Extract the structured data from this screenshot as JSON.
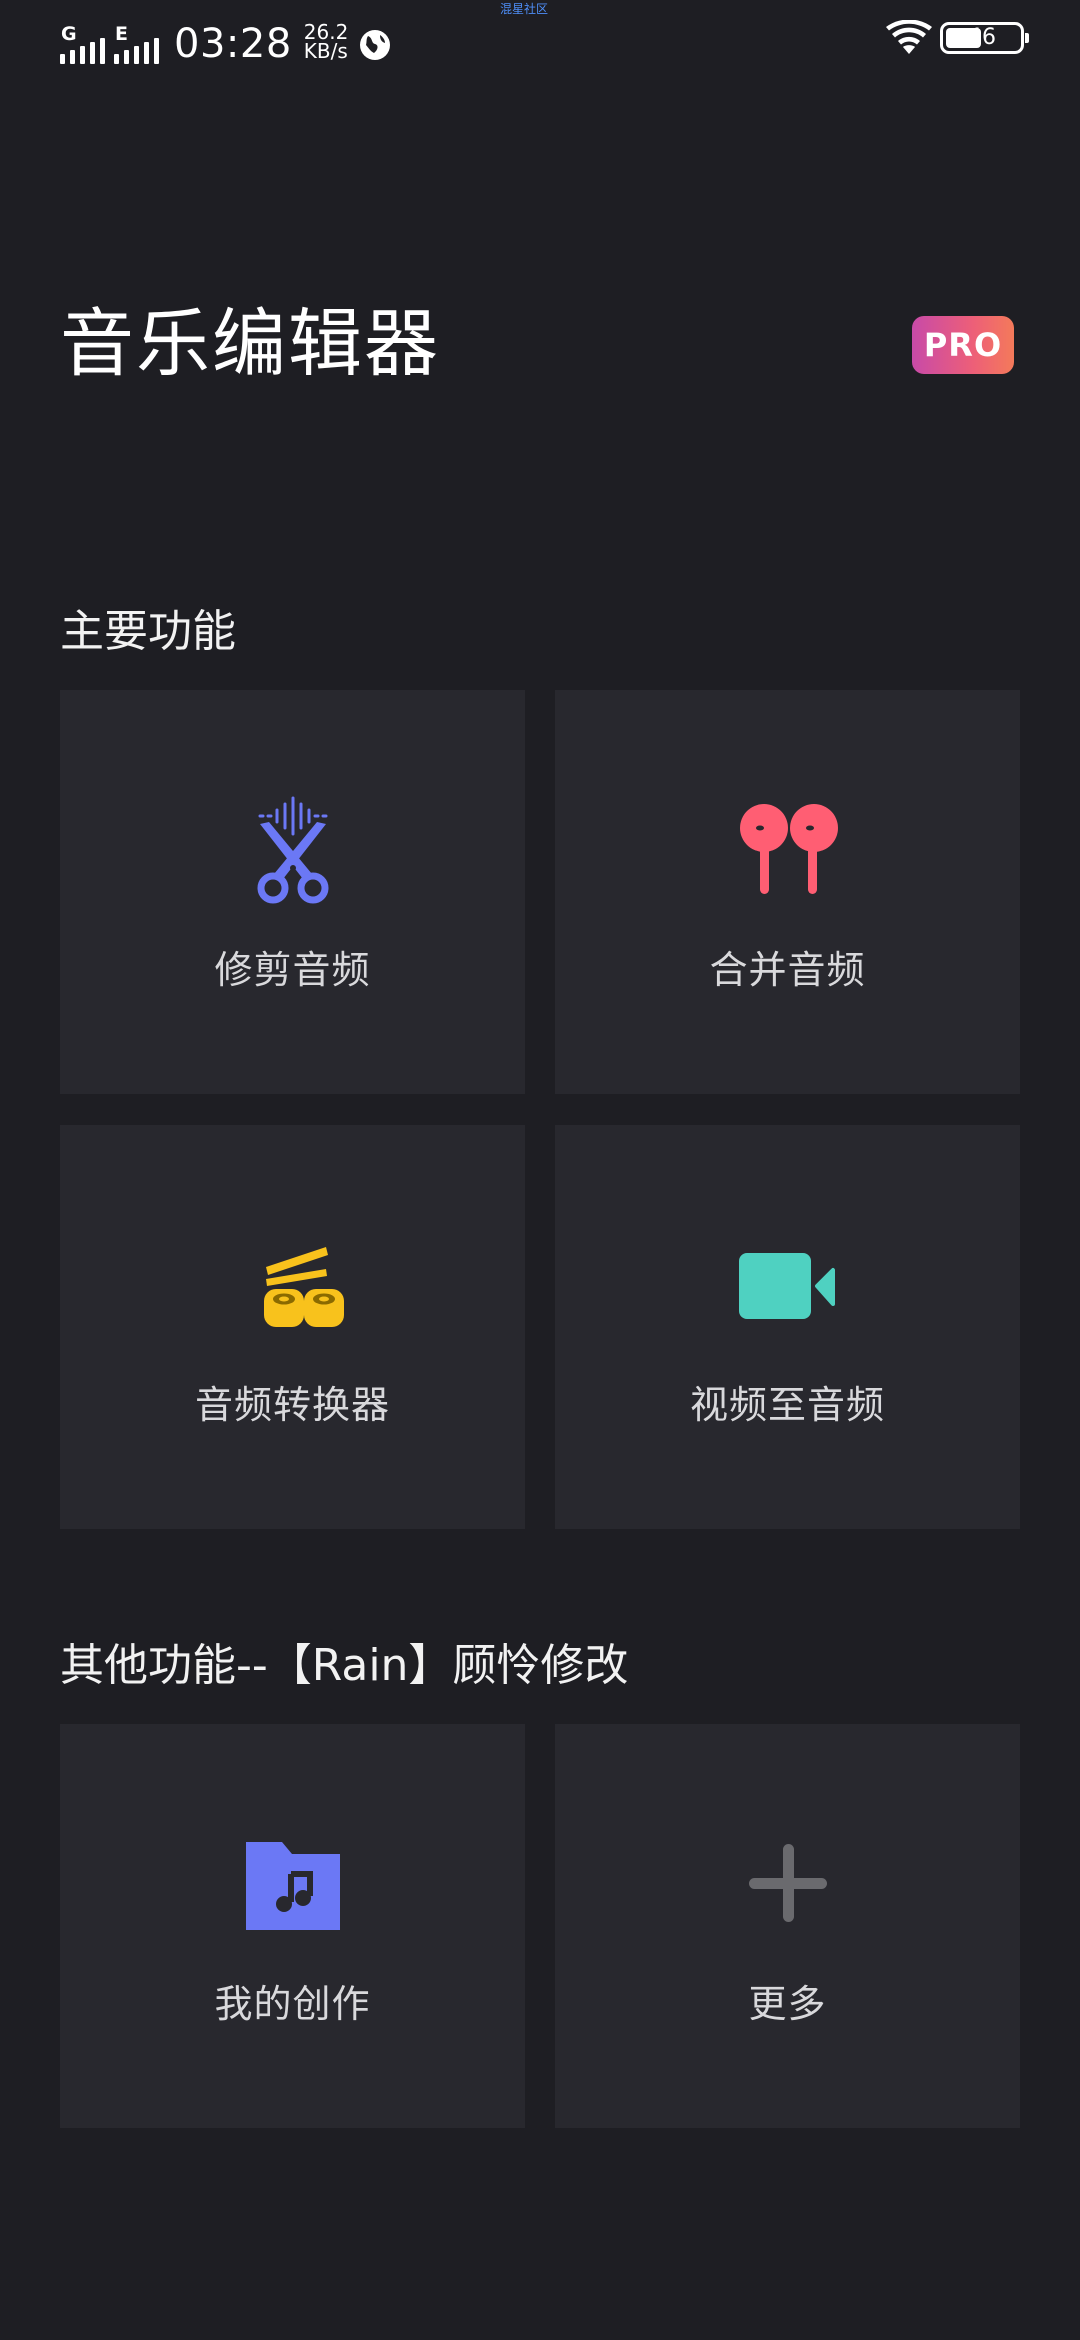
{
  "status_bar": {
    "network_1": "G",
    "network_2": "E",
    "time": "03:28",
    "speed_value": "26.2",
    "speed_unit": "KB/s",
    "carrier_text": "混星社区",
    "battery_level": "46"
  },
  "header": {
    "title": "音乐编辑器",
    "pro_label": "PRO"
  },
  "main_section": {
    "title": "主要功能",
    "items": [
      {
        "label": "修剪音频",
        "icon": "scissors-icon",
        "color": "#6b78f5"
      },
      {
        "label": "合并音频",
        "icon": "earbuds-icon",
        "color": "#ff5e73"
      },
      {
        "label": "音频转换器",
        "icon": "converter-icon",
        "color": "#f8c21c"
      },
      {
        "label": "视频至音频",
        "icon": "video-camera-icon",
        "color": "#4fd1c1"
      }
    ]
  },
  "other_section": {
    "title": "其他功能--【Rain】顾怜修改",
    "items": [
      {
        "label": "我的创作",
        "icon": "music-folder-icon",
        "color": "#6b78f5"
      },
      {
        "label": "更多",
        "icon": "plus-icon",
        "color": "#6a6a6e"
      }
    ]
  }
}
